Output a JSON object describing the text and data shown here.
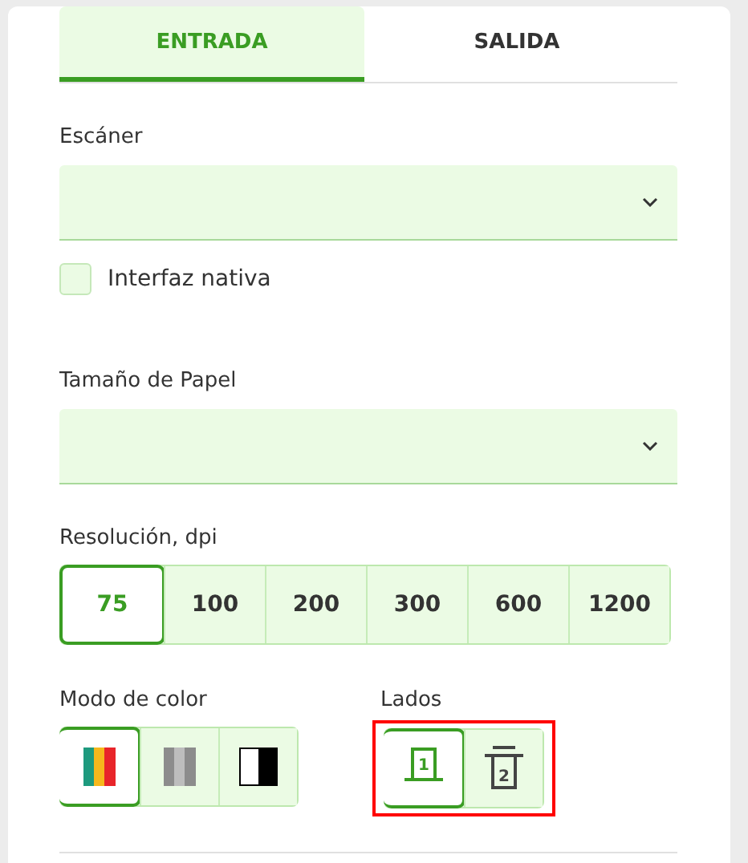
{
  "tabs": [
    {
      "label": "ENTRADA",
      "selected": true
    },
    {
      "label": "SALIDA",
      "selected": false
    }
  ],
  "scanner": {
    "label": "Escáner"
  },
  "native_interface": {
    "label": "Interfaz nativa",
    "checked": false
  },
  "paper_size": {
    "label": "Tamaño de Papel"
  },
  "resolution": {
    "label": "Resolución, dpi",
    "options": [
      {
        "label": "75",
        "selected": true
      },
      {
        "label": "100",
        "selected": false
      },
      {
        "label": "200",
        "selected": false
      },
      {
        "label": "300",
        "selected": false
      },
      {
        "label": "600",
        "selected": false
      },
      {
        "label": "1200",
        "selected": false
      }
    ]
  },
  "color_mode": {
    "label": "Modo de color",
    "options": [
      {
        "kind": "color",
        "selected": true
      },
      {
        "kind": "gray",
        "selected": false
      },
      {
        "kind": "bw",
        "selected": false
      }
    ]
  },
  "sides": {
    "label": "Lados",
    "highlighted": true,
    "options": [
      {
        "label": "1",
        "kind": "simplex",
        "selected": true
      },
      {
        "label": "2",
        "kind": "duplex",
        "selected": false
      }
    ]
  }
}
